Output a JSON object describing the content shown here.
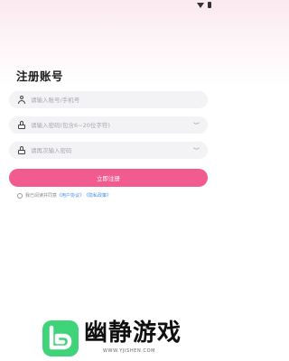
{
  "page": {
    "title": "注册账号"
  },
  "form": {
    "account_placeholder": "请输入账号/手机号",
    "password_placeholder": "请输入密码(包含6~20位字符)",
    "confirm_placeholder": "请再次输入密码",
    "submit_label": "立即注册"
  },
  "agreement": {
    "prefix": "我已阅读并同意",
    "user_agreement": "《用户协议》",
    "privacy_policy": "《隐私政策》"
  },
  "watermark": {
    "name": "幽静游戏",
    "url": "WWW.YJISHEN.COM"
  },
  "colors": {
    "accent": "#f25b8f",
    "link": "#4a8ddf",
    "field_bg": "#f3f3f6",
    "logo_green": "#3fd37a"
  },
  "icons": {
    "account": "user-icon",
    "password": "lock-icon",
    "confirm": "lock-icon",
    "visibility": "eye-closed-icon",
    "checkbox": "radio-unchecked-icon"
  }
}
